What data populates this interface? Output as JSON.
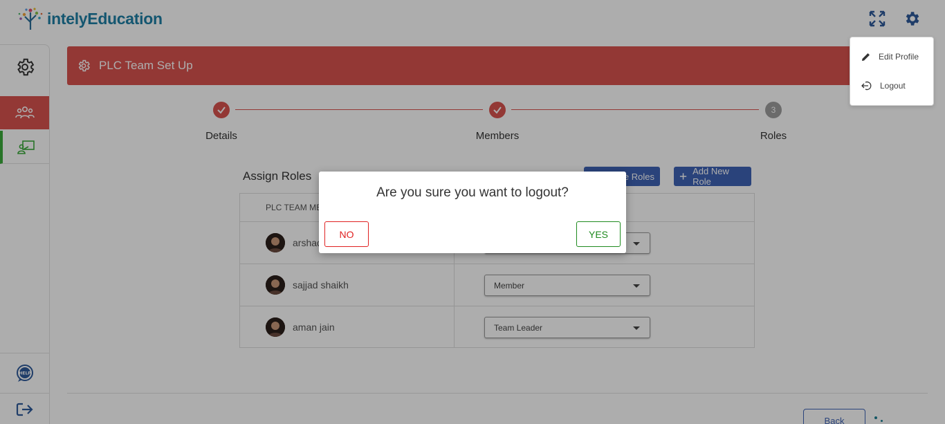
{
  "app": {
    "logo_text": "intelyEducation"
  },
  "header": {
    "fullscreen_icon": "expand-icon",
    "settings_icon": "gear-icon"
  },
  "sidebar": {
    "items": [
      {
        "icon": "gear-icon"
      },
      {
        "icon": "team-icon"
      },
      {
        "icon": "whiteboard-user-icon"
      }
    ],
    "help_icon": "help-bubble-icon",
    "logout_icon": "logout-icon"
  },
  "banner": {
    "title": "PLC Team Set Up"
  },
  "stepper": {
    "steps": [
      {
        "label": "Details",
        "state": "done"
      },
      {
        "label": "Members",
        "state": "done"
      },
      {
        "label": "Roles",
        "state": "current",
        "number": "3"
      }
    ]
  },
  "roles": {
    "title": "Assign Roles",
    "manage_label": "Manage Roles",
    "manage_visible": "ge Roles",
    "add_label": "Add New Role",
    "column_member": "PLC TEAM MEMBERS",
    "column_member_visible": "PLC TEAM ME",
    "rows": [
      {
        "name": "arshad",
        "name_visible": "arshad",
        "role": ""
      },
      {
        "name": "sajjad shaikh",
        "role": "Member"
      },
      {
        "name": "aman jain",
        "role": "Team Leader"
      }
    ]
  },
  "footer": {
    "back_label": "Back"
  },
  "profile_menu": {
    "items": [
      {
        "label": "Edit Profile",
        "icon": "pencil-icon"
      },
      {
        "label": "Logout",
        "icon": "logout-icon"
      }
    ]
  },
  "modal": {
    "question": "Are you sure you want to logout?",
    "no_label": "NO",
    "yes_label": "YES"
  },
  "colors": {
    "brand_red": "#d9534f",
    "brand_blue": "#3f63b5",
    "active_green": "#3cab3c",
    "no_red": "#e02020",
    "yes_green": "#1e8a1e"
  }
}
